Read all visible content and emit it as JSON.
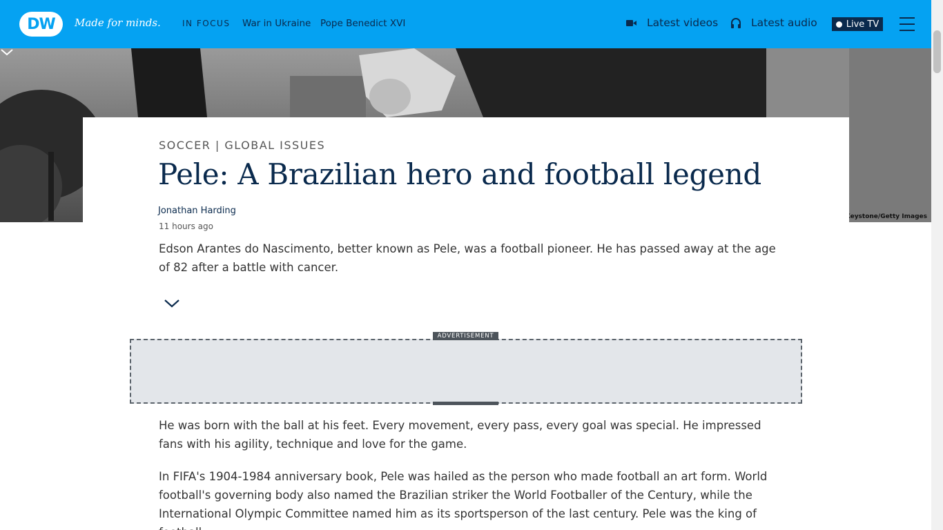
{
  "header": {
    "logo_text": "DW",
    "tagline": "Made for minds.",
    "in_focus_label": "IN FOCUS",
    "focus_links": [
      "War in Ukraine",
      "Pope Benedict XVI"
    ],
    "latest_videos": "Latest videos",
    "latest_audio": "Latest audio",
    "live_tv": "Live TV",
    "brand_color": "#05a2f2",
    "navy_color": "#0a2a4d"
  },
  "hero": {
    "credit": "ct/Keystone/Getty Images"
  },
  "article": {
    "kicker": "SOCCER | GLOBAL ISSUES",
    "headline": "Pele: A Brazilian hero and football legend",
    "author": "Jonathan Harding",
    "timestamp": "11 hours ago",
    "teaser": "Edson Arantes do Nascimento, better known as Pele, was a football pioneer. He has passed away at the age of 82 after a battle with cancer."
  },
  "advertisement": {
    "label": "ADVERTISEMENT"
  },
  "body": {
    "paragraphs": [
      "He was born with the ball at his feet. Every movement, every pass, every goal was special. He impressed fans with his agility, technique and love for the game.",
      "In FIFA's 1904-1984 anniversary book, Pele was hailed as the person who made football an art form. World football's governing body also named the Brazilian striker the World Footballer of the Century, while the International Olympic Committee named him as its sportsperson of the last century. Pele was the king of football"
    ]
  }
}
